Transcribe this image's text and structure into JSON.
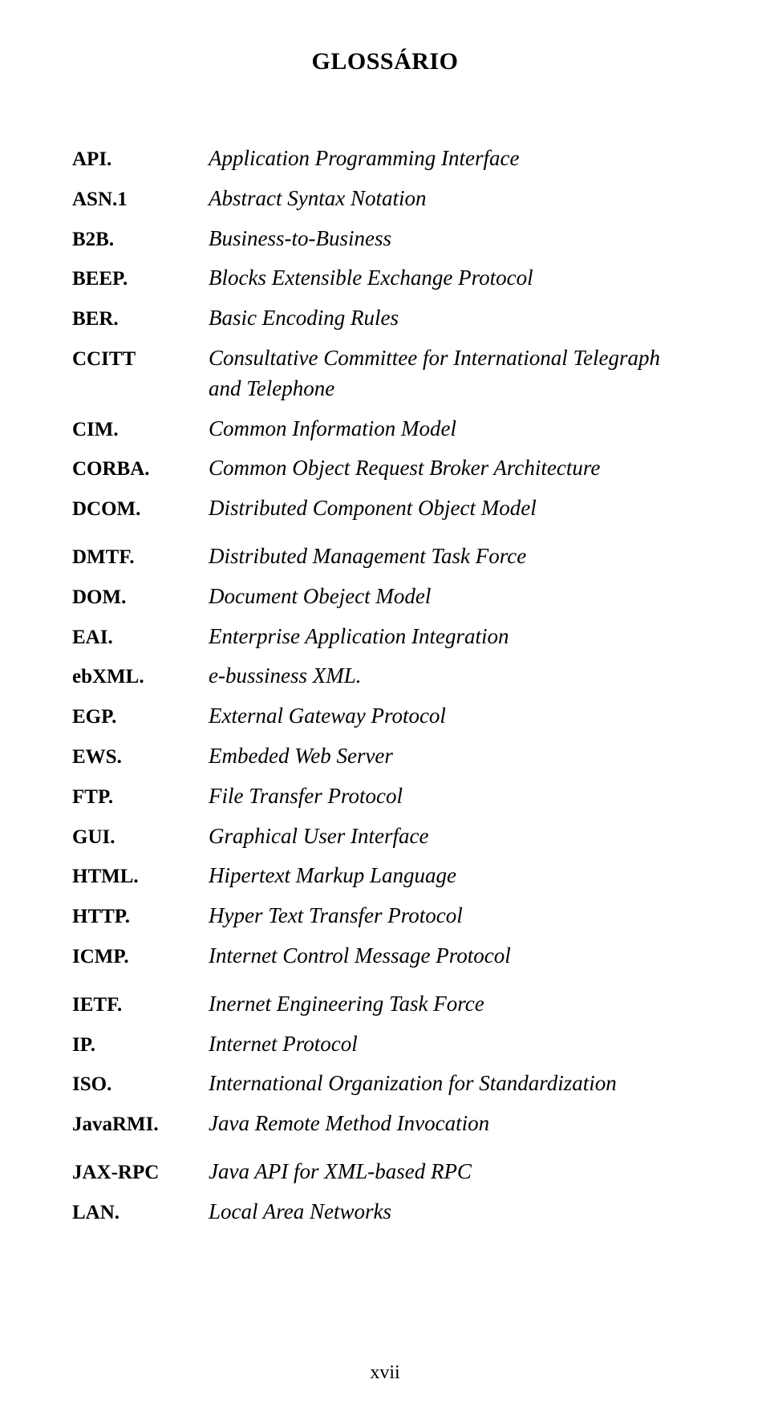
{
  "title": "GLOSSÁRIO",
  "terms": [
    {
      "term": "API.",
      "def": "Application Programming Interface"
    },
    {
      "term": "ASN.1",
      "def": "Abstract Syntax Notation"
    },
    {
      "term": "B2B.",
      "def": "Business-to-Business"
    },
    {
      "term": "BEEP.",
      "def": "Blocks Extensible Exchange Protocol"
    },
    {
      "term": "BER.",
      "def": "Basic Encoding Rules"
    },
    {
      "term": "CCITT",
      "def": "Consultative Committee for International Telegraph and Telephone"
    },
    {
      "term": "CIM.",
      "def": "Common Information Model"
    },
    {
      "term": "CORBA.",
      "def": "Common Object Request Broker Architecture"
    },
    {
      "term": "DCOM.",
      "def": "Distributed Component Object Model"
    },
    {
      "term": "DMTF.",
      "def": "Distributed Management Task Force",
      "gap": true
    },
    {
      "term": "DOM.",
      "def": "Document Obeject Model"
    },
    {
      "term": "EAI.",
      "def": "Enterprise Application Integration"
    },
    {
      "term": "ebXML.",
      "def": "e-bussiness XML."
    },
    {
      "term": "EGP.",
      "def": "External Gateway Protocol"
    },
    {
      "term": "EWS.",
      "def": "Embeded Web Server"
    },
    {
      "term": "FTP.",
      "def": "File Transfer Protocol"
    },
    {
      "term": "GUI.",
      "def": "Graphical User Interface"
    },
    {
      "term": "HTML.",
      "def": "Hipertext Markup Language"
    },
    {
      "term": "HTTP.",
      "def": "Hyper Text Transfer Protocol"
    },
    {
      "term": "ICMP.",
      "def": "Internet Control Message Protocol"
    },
    {
      "term": "IETF.",
      "def": "Inernet Engineering Task Force",
      "gap": true
    },
    {
      "term": "IP.",
      "def": "Internet Protocol"
    },
    {
      "term": "ISO.",
      "def": "International Organization for Standardization"
    },
    {
      "term": "JavaRMI.",
      "def": "Java Remote Method Invocation"
    },
    {
      "term": "JAX-RPC",
      "def": "Java API for XML-based RPC",
      "gap": true
    },
    {
      "term": "LAN.",
      "def": "Local Area Networks"
    }
  ],
  "page_number": "xvii"
}
